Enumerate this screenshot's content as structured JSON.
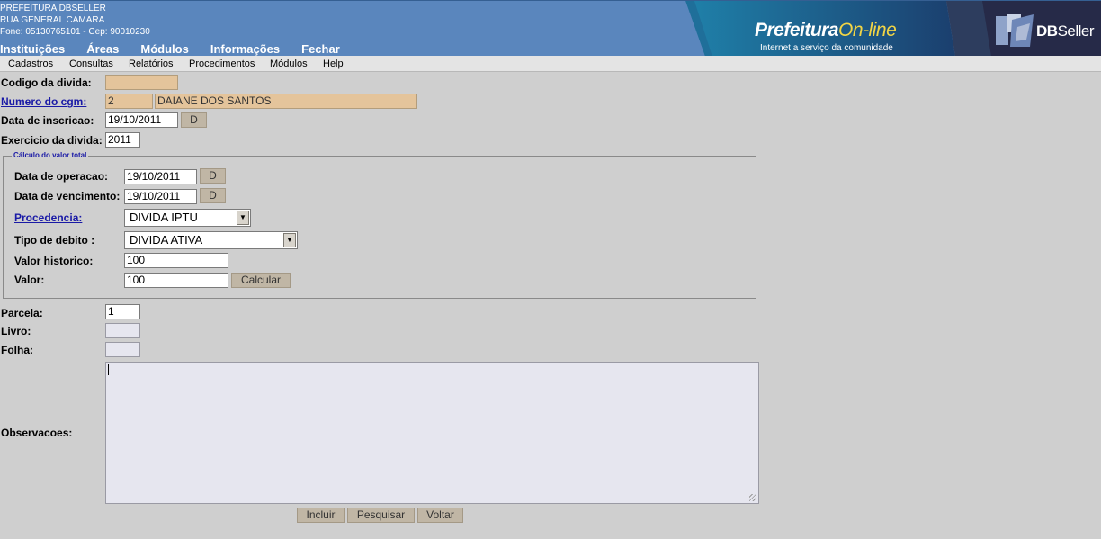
{
  "header": {
    "org_name": "PREFEITURA DBSELLER",
    "org_address": "RUA GENERAL CAMARA",
    "org_contact": "Fone: 05130765101  -  Cep: 90010230",
    "menu": [
      "Instituições",
      "Áreas",
      "Módulos",
      "Informações",
      "Fechar"
    ],
    "brand_main": "Prefeitura",
    "brand_accent": "On-line",
    "brand_tagline": "Internet a serviço da comunidade",
    "dbseller_bold": "DB",
    "dbseller_rest": "Seller"
  },
  "submenu": [
    "Cadastros",
    "Consultas",
    "Relatórios",
    "Procedimentos",
    "Módulos",
    "Help"
  ],
  "form": {
    "codigo_label": "Codigo da divida:",
    "codigo_value": "",
    "cgm_label": "Numero do cgm:",
    "cgm_value": "2",
    "cgm_name": "DAIANE DOS SANTOS",
    "inscricao_label": "Data de inscricao:",
    "inscricao_value": "19/10/2011",
    "date_button": "D",
    "exercicio_label": "Exercicio da divida:",
    "exercicio_value": "2011",
    "fieldset_legend": "Cálculo do valor total",
    "operacao_label": "Data de operacao:",
    "operacao_value": "19/10/2011",
    "vencimento_label": "Data de vencimento:",
    "vencimento_value": "19/10/2011",
    "procedencia_label": "Procedencia:",
    "procedencia_value": "DIVIDA IPTU",
    "tipo_label": "Tipo de debito :",
    "tipo_value": "DIVIDA ATIVA",
    "historico_label": "Valor historico:",
    "historico_value": "100",
    "valor_label": "Valor:",
    "valor_value": "100",
    "calcular_button": "Calcular",
    "parcela_label": "Parcela:",
    "parcela_value": "1",
    "livro_label": "Livro:",
    "livro_value": "",
    "folha_label": "Folha:",
    "folha_value": "",
    "observacoes_label": "Observacoes:",
    "observacoes_value": ""
  },
  "actions": {
    "incluir": "Incluir",
    "pesquisar": "Pesquisar",
    "voltar": "Voltar"
  },
  "colors": {
    "header_blue": "#5a86bd",
    "readonly_fill": "#e4c49b",
    "button_fill": "#c0b6a5",
    "link_blue": "#1a1aa6",
    "brand_yellow": "#f2d545"
  }
}
